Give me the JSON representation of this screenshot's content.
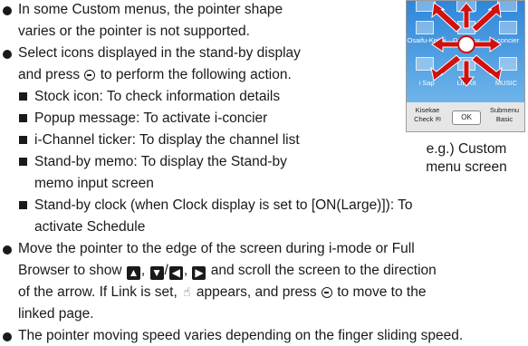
{
  "colors": {
    "text": "#1a1a1a",
    "screen_blue": "#2f86d9",
    "arrow_red": "#d11010"
  },
  "list": {
    "b1": {
      "line1": "In some Custom menus, the pointer shape",
      "line2": "varies or the pointer is not supported."
    },
    "b2": {
      "line1": "Select icons displayed in the stand-by display",
      "line2_a": "and press ",
      "line2_b": " to perform the following action.",
      "subitems": [
        {
          "line1": "Stock icon: To check information details"
        },
        {
          "line1": "Popup message: To activate i-concier"
        },
        {
          "line1": "i-Channel ticker: To display the channel list"
        },
        {
          "line1": "Stand-by memo: To display the Stand-by",
          "line2": "memo input screen"
        },
        {
          "line1": "Stand-by clock (when Clock display is set to [ON(Large)]): To",
          "line2": "activate Schedule"
        }
      ]
    },
    "b3": {
      "line1": "Move the pointer to the edge of the screen during i-mode or Full",
      "line2_a": "Browser to show ",
      "line2_b": ", ",
      "line2_c": "/",
      "line2_d": ", ",
      "line2_e": " and scroll the screen to the direction",
      "line3_a": "of the arrow. If Link is set, ",
      "line3_b": " appears, and press ",
      "line3_c": " to move to the",
      "line4": "linked page."
    },
    "b4": {
      "line1": "The pointer moving speed varies depending on the finger sliding speed."
    }
  },
  "icons": {
    "up_arrow": "up-arrow-key-icon",
    "down": "down-arrow-key-icon",
    "left": "left-arrow-key-icon",
    "right": "right-arrow-key-icon",
    "hand": "hand-pointer-icon",
    "center_key": "center-key-icon"
  },
  "screen": {
    "row1_labels": [
      "Osaifu-Keitai",
      "Data box",
      "i-concier"
    ],
    "row2_labels": [
      "i Sap",
      "LifeKit",
      "MUSIC"
    ],
    "soft_left": [
      "Kisekae",
      "Check ✉"
    ],
    "ok_label": "OK",
    "soft_right": [
      "Submenu",
      "Basic"
    ]
  },
  "caption": {
    "line1": "e.g.) Custom",
    "line2": "menu screen"
  }
}
